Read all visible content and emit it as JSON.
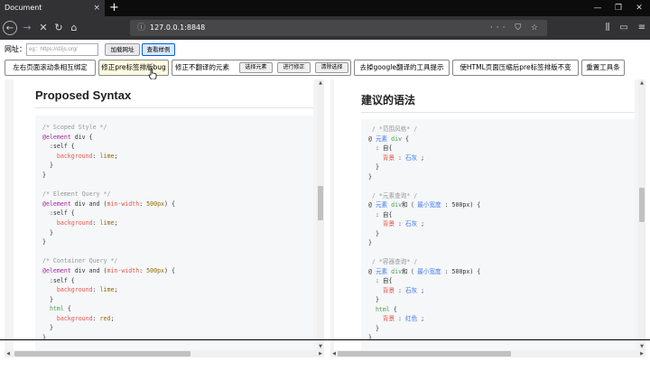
{
  "browser": {
    "tab_title": "Document",
    "tab_close": "×",
    "new_tab": "+",
    "url": "127.0.0.1:8848",
    "url_actions": "··· ⛉ ☆"
  },
  "controls": {
    "url_label": "网址：",
    "url_placeholder": "eg：https://d3js.org/",
    "load_button": "加载网址",
    "example_button": "查看样例"
  },
  "toolbar": {
    "sync_scroll": "左右页面滚动条相互绑定",
    "prevent_pre_bug": "修正pre标签排版bug",
    "no_translate_label": "修正不翻译的元素",
    "select_element": "选择元素",
    "do_fix": "进行修正",
    "clear_selection": "清除选择",
    "drop_google_hint": "去掉google翻译的工具提示",
    "fix_pre_compress": "使HTML页面压缩后pre标签排版不变",
    "reset_toolbar": "重置工具条"
  },
  "left": {
    "title": "Proposed Syntax"
  },
  "right": {
    "title": "建议的语法"
  }
}
